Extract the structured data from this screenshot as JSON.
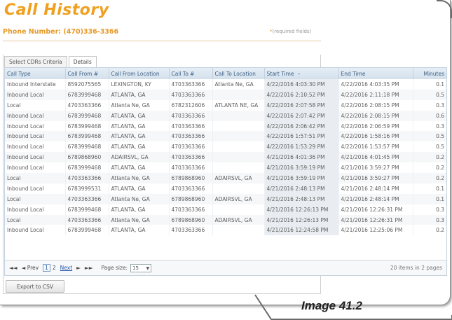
{
  "page": {
    "title": "Call History",
    "phone_label": "Phone Number: (470)336-3366",
    "required_star": "*",
    "required_text": "(required fields)"
  },
  "tabs": [
    "Select CDRs Criteria",
    "Details"
  ],
  "grid": {
    "columns": [
      "Call Type",
      "Call From #",
      "Call From Location",
      "Call To #",
      "Call To Location",
      "Start Time",
      "End Time",
      "Minutes"
    ],
    "sort_indicator": "–",
    "rows": [
      [
        "Inbound Interstate",
        "8592075565",
        "LEXINGTON, KY",
        "4703363366",
        "Atlanta Ne, GA",
        "4/22/2016 4:03:30 PM",
        "4/22/2016 4:03:35 PM",
        "0.1"
      ],
      [
        "Inbound Local",
        "6783999468",
        "ATLANTA, GA",
        "4703363366",
        "",
        "4/22/2016 2:10:52 PM",
        "4/22/2016 2:11:18 PM",
        "0.5"
      ],
      [
        "Local",
        "4703363366",
        "Atlanta Ne, GA",
        "6782312606",
        "ATLANTA NE, GA",
        "4/22/2016 2:07:58 PM",
        "4/22/2016 2:08:15 PM",
        "0.3"
      ],
      [
        "Inbound Local",
        "6783999468",
        "ATLANTA, GA",
        "4703363366",
        "",
        "4/22/2016 2:07:42 PM",
        "4/22/2016 2:08:15 PM",
        "0.6"
      ],
      [
        "Inbound Local",
        "6783999468",
        "ATLANTA, GA",
        "4703363366",
        "",
        "4/22/2016 2:06:42 PM",
        "4/22/2016 2:06:59 PM",
        "0.3"
      ],
      [
        "Inbound Local",
        "6783999468",
        "ATLANTA, GA",
        "4703363366",
        "",
        "4/22/2016 1:57:51 PM",
        "4/22/2016 1:58:16 PM",
        "0.5"
      ],
      [
        "Inbound Local",
        "6783999468",
        "ATLANTA, GA",
        "4703363366",
        "",
        "4/22/2016 1:53:29 PM",
        "4/22/2016 1:53:57 PM",
        "0.5"
      ],
      [
        "Inbound Local",
        "6789868960",
        "ADAIRSVL, GA",
        "4703363366",
        "",
        "4/21/2016 4:01:36 PM",
        "4/21/2016 4:01:45 PM",
        "0.2"
      ],
      [
        "Inbound Local",
        "6783999468",
        "ATLANTA, GA",
        "4703363366",
        "",
        "4/21/2016 3:59:19 PM",
        "4/21/2016 3:59:27 PM",
        "0.2"
      ],
      [
        "Local",
        "4703363366",
        "Atlanta Ne, GA",
        "6789868960",
        "ADAIRSVL, GA",
        "4/21/2016 3:59:19 PM",
        "4/21/2016 3:59:27 PM",
        "0.2"
      ],
      [
        "Inbound Local",
        "6783999531",
        "ATLANTA, GA",
        "4703363366",
        "",
        "4/21/2016 2:48:13 PM",
        "4/21/2016 2:48:14 PM",
        "0.1"
      ],
      [
        "Local",
        "4703363366",
        "Atlanta Ne, GA",
        "6789868960",
        "ADAIRSVL, GA",
        "4/21/2016 2:48:13 PM",
        "4/21/2016 2:48:14 PM",
        "0.1"
      ],
      [
        "Inbound Local",
        "6783999468",
        "ATLANTA, GA",
        "4703363366",
        "",
        "4/21/2016 12:26:13 PM",
        "4/21/2016 12:26:31 PM",
        "0.3"
      ],
      [
        "Local",
        "4703363366",
        "Atlanta Ne, GA",
        "6789868960",
        "ADAIRSVL, GA",
        "4/21/2016 12:26:13 PM",
        "4/21/2016 12:26:31 PM",
        "0.3"
      ],
      [
        "Inbound Local",
        "6783999468",
        "ATLANTA, GA",
        "4703363366",
        "",
        "4/21/2016 12:24:58 PM",
        "4/21/2016 12:25:06 PM",
        "0.2"
      ]
    ]
  },
  "pager": {
    "first": "◄◄",
    "prev_arrow": "◄",
    "prev_label": "Prev",
    "current_page": "1",
    "page_2": "2",
    "next_label": "Next",
    "next_arrow": "►",
    "last": "►►",
    "page_size_label": "Page size:",
    "page_size_value": "15",
    "items_text": "20 items in 2 pages"
  },
  "export_label": "Export to CSV",
  "caption": "Image 41.2",
  "colors": {
    "title": "#f0a020",
    "header_text": "#3b5f82",
    "link": "#2255aa"
  }
}
